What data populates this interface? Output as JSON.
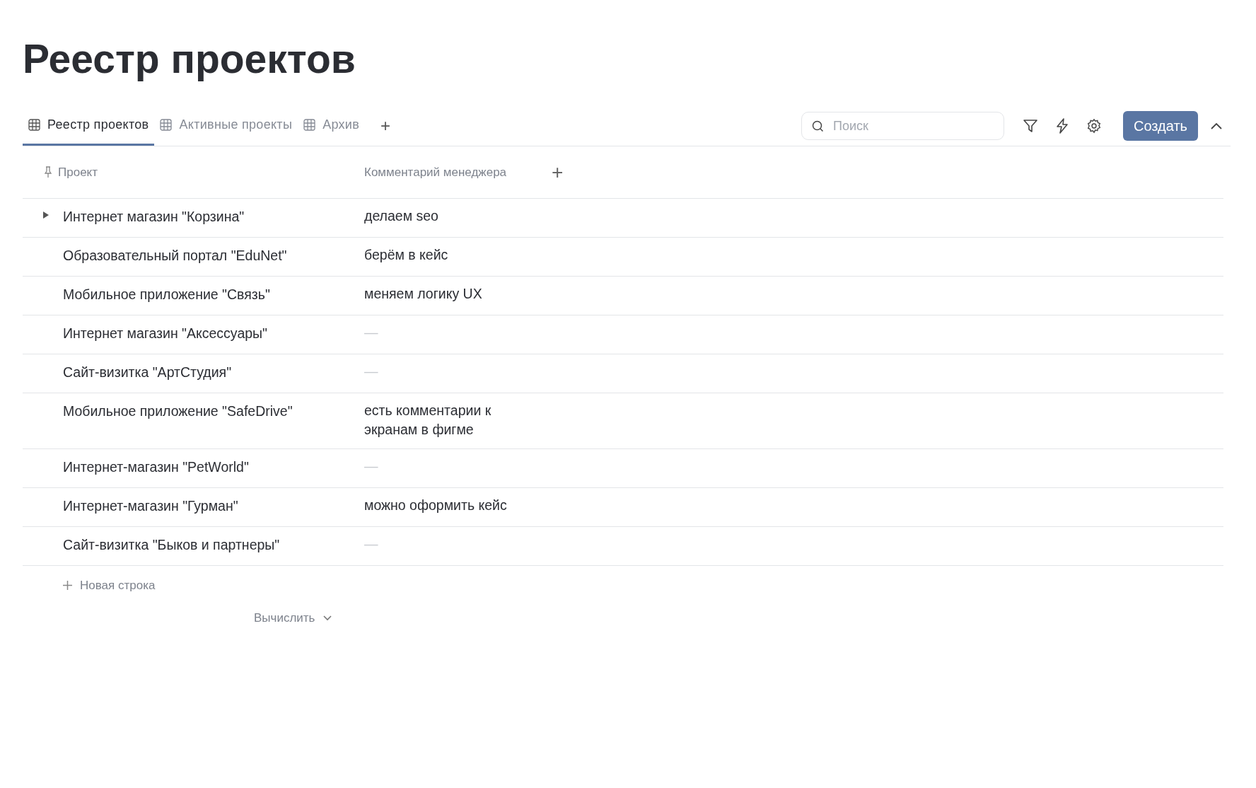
{
  "page": {
    "title": "Реестр проектов"
  },
  "tabs": [
    {
      "label": "Реестр проектов",
      "selected": true
    },
    {
      "label": "Активные проекты",
      "selected": false
    },
    {
      "label": "Архив",
      "selected": false
    }
  ],
  "add_tab": "+",
  "search": {
    "placeholder": "Поиск"
  },
  "create_button": "Создать",
  "table": {
    "columns": [
      "Проект",
      "Комментарий менеджера"
    ],
    "add_column": "+",
    "rows": [
      {
        "kind": "parent",
        "expanded": false,
        "project": "Интернет магазин \"Корзина\"",
        "comment": "делаем seo",
        "empty": false
      },
      {
        "kind": "leaf",
        "project": "Образовательный портал \"EduNet\"",
        "comment": "берём в кейс",
        "empty": false
      },
      {
        "kind": "leaf",
        "project": "Мобильное приложение \"Связь\"",
        "comment": "меняем логику UX",
        "empty": false
      },
      {
        "kind": "leaf",
        "project": "Интернет магазин \"Аксессуары\"",
        "comment": "—",
        "empty": true
      },
      {
        "kind": "leaf",
        "project": "Сайт-визитка \"АртСтудия\"",
        "comment": "—",
        "empty": true
      },
      {
        "kind": "leaf",
        "project": "Мобильное приложение \"SafeDrive\"",
        "comment": "есть комментарии к экранам в фигме",
        "empty": false
      },
      {
        "kind": "leaf",
        "project": "Интернет-магазин \"PetWorld\"",
        "comment": "—",
        "empty": true
      },
      {
        "kind": "leaf",
        "project": "Интернет-магазин \"Гурман\"",
        "comment": "можно оформить кейс",
        "empty": false
      },
      {
        "kind": "leaf",
        "project": "Сайт-визитка \"Быков и партнеры\"",
        "comment": "—",
        "empty": true
      }
    ],
    "new_row": "Новая строка",
    "calculate": "Вычислить"
  }
}
